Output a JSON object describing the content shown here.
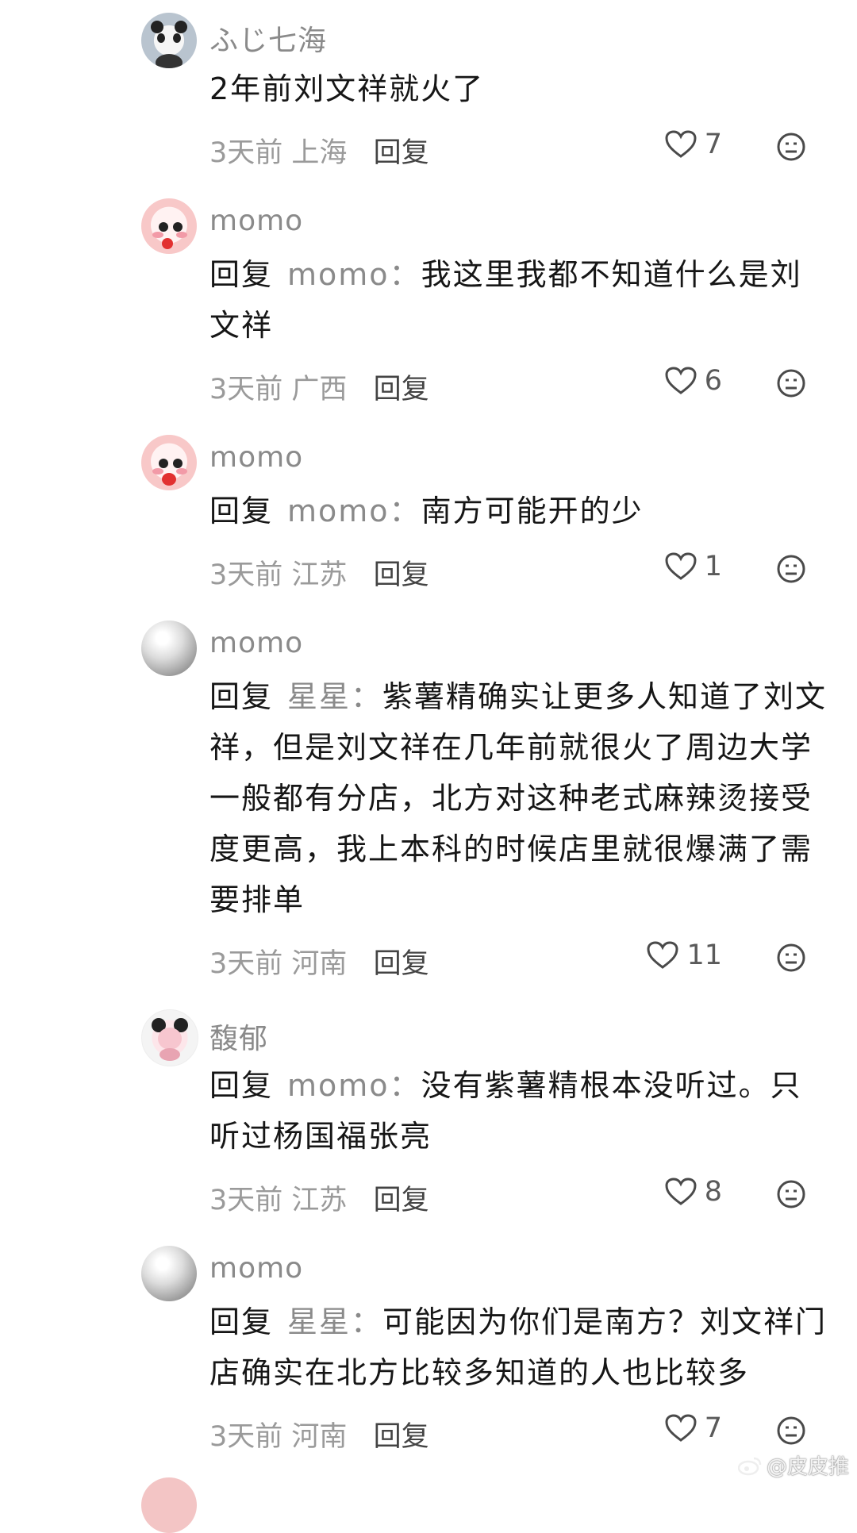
{
  "comments": [
    {
      "avatar": "panda-avatar",
      "username": "ふじ七海",
      "reply_prefix": "",
      "target": "",
      "text": "2年前刘文祥就火了",
      "time": "3天前",
      "location": "上海",
      "reply_label": "回复",
      "likes": "7"
    },
    {
      "avatar": "pink-cartoon-avatar",
      "username": "momo",
      "reply_prefix": "回复",
      "target": "momo",
      "text": "我这里我都不知道什么是刘文祥",
      "time": "3天前",
      "location": "广西",
      "reply_label": "回复",
      "likes": "6"
    },
    {
      "avatar": "pink-cartoon-avatar",
      "username": "momo",
      "reply_prefix": "回复",
      "target": "momo",
      "text": "南方可能开的少",
      "time": "3天前",
      "location": "江苏",
      "reply_label": "回复",
      "likes": "1"
    },
    {
      "avatar": "pearl-avatar",
      "username": "momo",
      "reply_prefix": "回复",
      "target": "星星",
      "text": "紫薯精确实让更多人知道了刘文祥，但是刘文祥在几年前就很火了周边大学一般都有分店，北方对这种老式麻辣烫接受度更高，我上本科的时候店里就很爆满了需要排单",
      "time": "3天前",
      "location": "河南",
      "reply_label": "回复",
      "likes": "11"
    },
    {
      "avatar": "doll-avatar",
      "username": "馥郁",
      "reply_prefix": "回复",
      "target": "momo",
      "text": "没有紫薯精根本没听过。只听过杨国福张亮",
      "time": "3天前",
      "location": "江苏",
      "reply_label": "回复",
      "likes": "8"
    },
    {
      "avatar": "pearl-avatar",
      "username": "momo",
      "reply_prefix": "回复",
      "target": "星星",
      "text": "可能因为你们是南方？刘文祥门店确实在北方比较多知道的人也比较多",
      "time": "3天前",
      "location": "河南",
      "reply_label": "回复",
      "likes": "7"
    }
  ],
  "separator": "：",
  "watermark": "@皮皮推",
  "colors": {
    "username": "#8a8a8a",
    "meta": "#9a9a9a",
    "text": "#161616"
  }
}
